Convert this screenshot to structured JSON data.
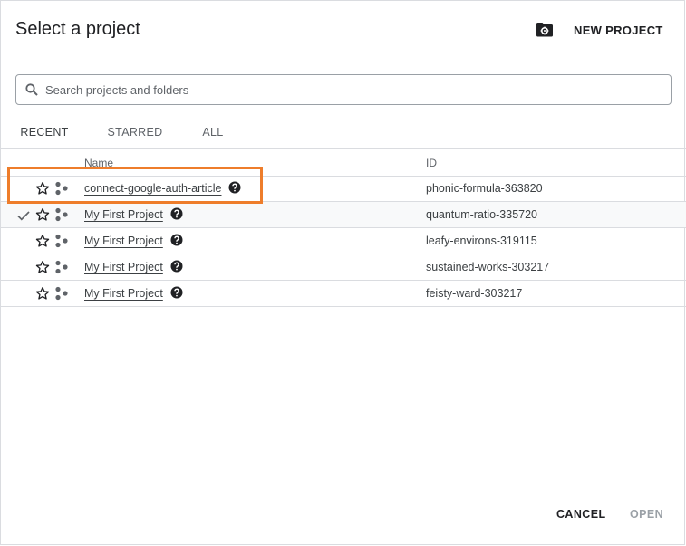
{
  "dialog": {
    "title": "Select a project",
    "new_project_label": "NEW PROJECT"
  },
  "search": {
    "placeholder": "Search projects and folders"
  },
  "tabs": [
    {
      "label": "RECENT",
      "active": true
    },
    {
      "label": "STARRED",
      "active": false
    },
    {
      "label": "ALL",
      "active": false
    }
  ],
  "table": {
    "headers": {
      "name": "Name",
      "id": "ID"
    },
    "rows": [
      {
        "name": "connect-google-auth-article",
        "id": "phonic-formula-363820",
        "current": false,
        "highlighted": true
      },
      {
        "name": "My First Project",
        "id": "quantum-ratio-335720",
        "current": true,
        "highlighted": false
      },
      {
        "name": "My First Project",
        "id": "leafy-environs-319115",
        "current": false,
        "highlighted": false
      },
      {
        "name": "My First Project",
        "id": "sustained-works-303217",
        "current": false,
        "highlighted": false
      },
      {
        "name": "My First Project",
        "id": "feisty-ward-303217",
        "current": false,
        "highlighted": false
      }
    ]
  },
  "footer": {
    "cancel_label": "CANCEL",
    "open_label": "OPEN"
  },
  "colors": {
    "highlight_border": "#ee7d2b",
    "disabled_text": "#9aa0a6"
  },
  "icons": [
    "folder-settings-icon",
    "search-icon",
    "star-outline-icon",
    "project-type-icon",
    "help-icon",
    "check-icon"
  ]
}
